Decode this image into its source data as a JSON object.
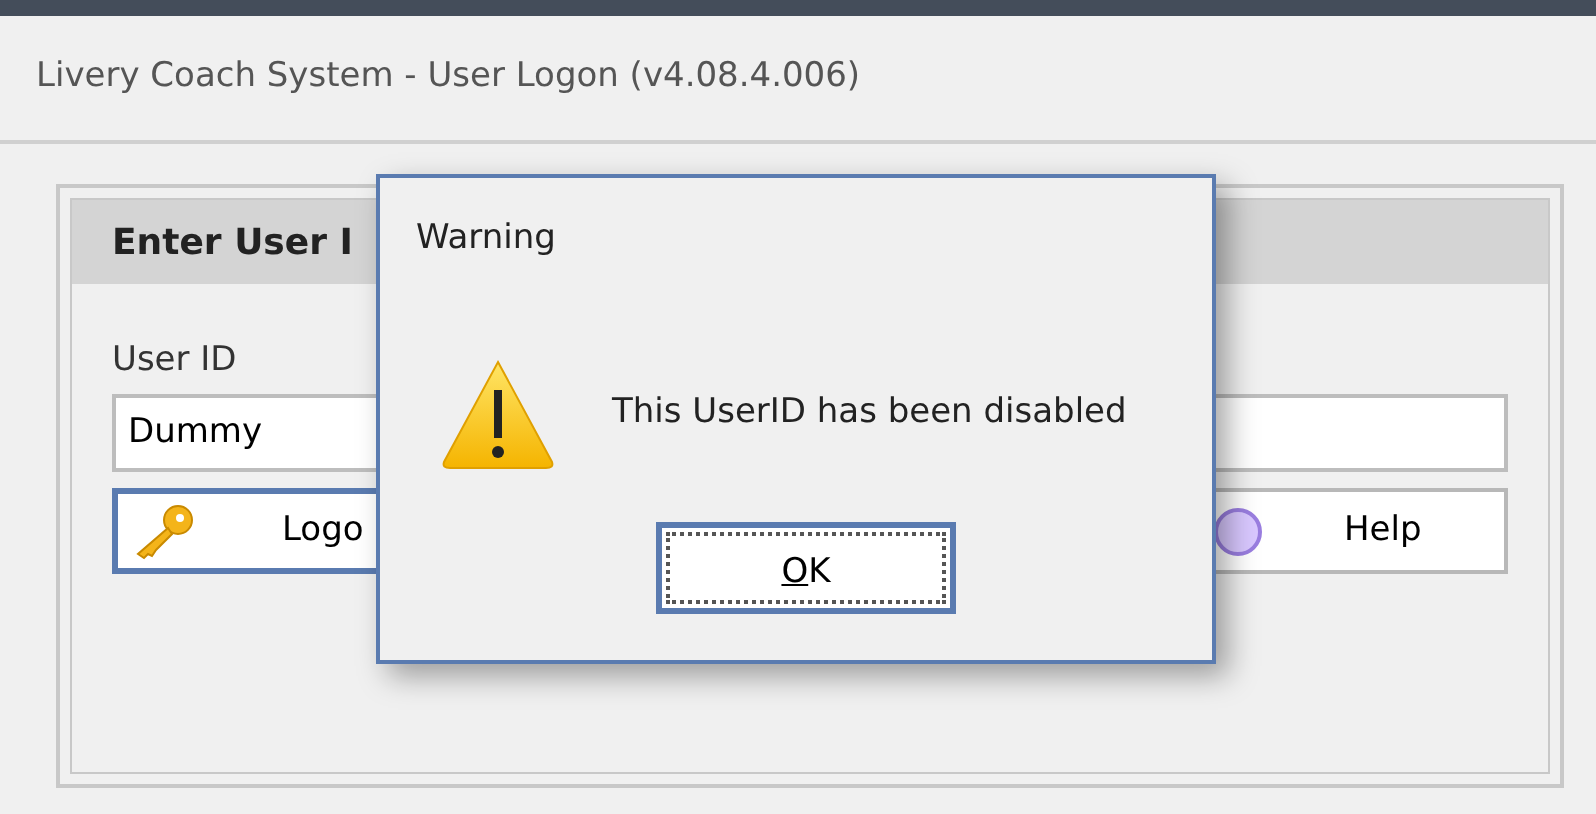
{
  "window": {
    "title": "Livery Coach System - User Logon (v4.08.4.006)"
  },
  "panel": {
    "heading": "Enter User I",
    "user_id_label": "User ID",
    "user_id_value": "Dummy",
    "buttons": [
      {
        "label": "Logo",
        "kind": "logon"
      },
      {
        "label": "Help",
        "kind": "help"
      }
    ]
  },
  "dialog": {
    "title": "Warning",
    "message": "This UserID has been disabled",
    "button": "OK"
  }
}
